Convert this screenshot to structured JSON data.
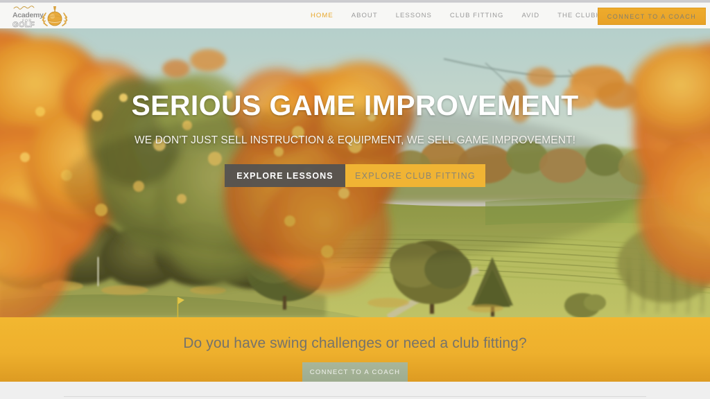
{
  "site": {
    "logo": {
      "script_line": "Bill Alexander",
      "line1": "Academy",
      "line2": "FOR",
      "line3": "GOLF",
      "emblem_icon": "golf-ball-trophy-icon"
    }
  },
  "nav": {
    "items": [
      {
        "label": "HOME",
        "active": true
      },
      {
        "label": "ABOUT",
        "active": false
      },
      {
        "label": "LESSONS",
        "active": false
      },
      {
        "label": "CLUB FITTING",
        "active": false
      },
      {
        "label": "AVID",
        "active": false
      },
      {
        "label": "THE CLUBHOUSE",
        "active": false
      }
    ],
    "cta_label": "CONNECT TO A COACH"
  },
  "hero": {
    "title": "SERIOUS GAME IMPROVEMENT",
    "subtitle": "WE DON'T JUST SELL INSTRUCTION & EQUIPMENT, WE SELL GAME IMPROVEMENT!",
    "primary_button": "EXPLORE LESSONS",
    "secondary_button": "EXPLORE CLUB FITTING",
    "image_description": "Autumn golf course fairway framed by orange maple foliage with a yellow flagstick on the green"
  },
  "cta_band": {
    "question": "Do you have swing challenges or need a club fitting?",
    "button_label": "CONNECT TO A COACH"
  },
  "colors": {
    "brand_gold": "#eeab2c",
    "band_gold": "#f0b434",
    "nav_text": "#9a9a9a",
    "active_nav": "#e8a72a",
    "dark_button": "#525252",
    "sage_button": "#a3b193",
    "header_bg": "#f7f7f5",
    "page_bg": "#efefef"
  }
}
